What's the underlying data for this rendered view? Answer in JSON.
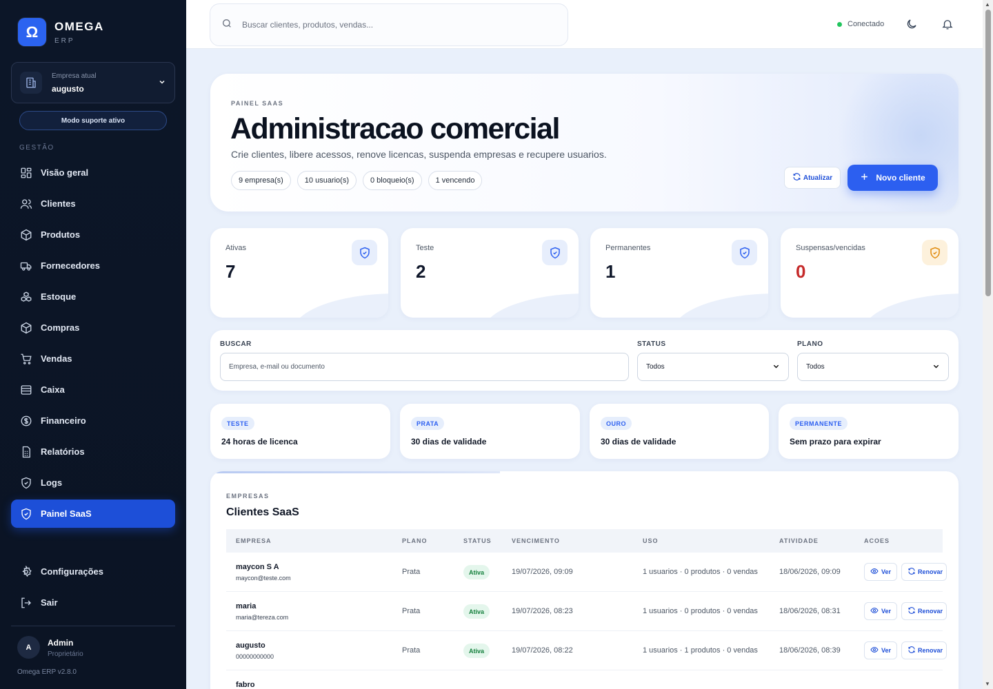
{
  "brand": {
    "logo_glyph": "Ω",
    "name": "OMEGA",
    "sub": "ERP"
  },
  "company": {
    "label": "Empresa atual",
    "name": "augusto"
  },
  "support_badge": "Modo suporte ativo",
  "sidebar": {
    "section": "GESTÃO",
    "items": [
      {
        "label": "Visão geral",
        "icon": "grid-icon"
      },
      {
        "label": "Clientes",
        "icon": "users-icon"
      },
      {
        "label": "Produtos",
        "icon": "package-icon"
      },
      {
        "label": "Fornecedores",
        "icon": "truck-icon"
      },
      {
        "label": "Estoque",
        "icon": "boxes-icon"
      },
      {
        "label": "Compras",
        "icon": "package-icon"
      },
      {
        "label": "Vendas",
        "icon": "cart-icon"
      },
      {
        "label": "Caixa",
        "icon": "wallet-icon"
      },
      {
        "label": "Financeiro",
        "icon": "dollar-icon"
      },
      {
        "label": "Relatórios",
        "icon": "report-icon"
      },
      {
        "label": "Logs",
        "icon": "shield-icon"
      },
      {
        "label": "Painel SaaS",
        "icon": "shield-icon",
        "active": true
      }
    ],
    "bottom_items": [
      {
        "label": "Configurações",
        "icon": "gear-icon"
      },
      {
        "label": "Sair",
        "icon": "logout-icon"
      }
    ],
    "user": {
      "initial": "A",
      "name": "Admin",
      "role": "Proprietário"
    },
    "version": "Omega ERP v2.8.0"
  },
  "topbar": {
    "search_placeholder": "Buscar clientes, produtos, vendas...",
    "status": "Conectado",
    "status_color": "#22c55e"
  },
  "hero": {
    "kicker": "PAINEL SAAS",
    "title": "Administracao comercial",
    "subtitle": "Crie clientes, libere acessos, renove licencas, suspenda empresas e recupere usuarios.",
    "chips": [
      "9 empresa(s)",
      "10 usuario(s)",
      "0 bloqueio(s)",
      "1 vencendo"
    ],
    "refresh_label": "Atualizar",
    "new_label": "Novo cliente"
  },
  "stats": [
    {
      "label": "Ativas",
      "value": "7"
    },
    {
      "label": "Teste",
      "value": "2"
    },
    {
      "label": "Permanentes",
      "value": "1"
    },
    {
      "label": "Suspensas/vencidas",
      "value": "0",
      "accent": "#c52a2a"
    }
  ],
  "filters": {
    "search_label": "BUSCAR",
    "search_placeholder": "Empresa, e-mail ou documento",
    "status_label": "STATUS",
    "status_value": "Todos",
    "plan_label": "PLANO",
    "plan_value": "Todos"
  },
  "plans": [
    {
      "tag": "TESTE",
      "desc": "24 horas de licenca"
    },
    {
      "tag": "PRATA",
      "desc": "30 dias de validade"
    },
    {
      "tag": "OURO",
      "desc": "30 dias de validade"
    },
    {
      "tag": "PERMANENTE",
      "desc": "Sem prazo para expirar"
    }
  ],
  "table": {
    "kicker": "EMPRESAS",
    "title": "Clientes SaaS",
    "columns": [
      "EMPRESA",
      "PLANO",
      "STATUS",
      "VENCIMENTO",
      "USO",
      "ATIVIDADE",
      "ACOES"
    ],
    "view_label": "Ver",
    "renew_label": "Renovar",
    "rows": [
      {
        "name": "maycon S A",
        "email": "maycon@teste.com",
        "plan": "Prata",
        "status": "Ativa",
        "due": "19/07/2026, 09:09",
        "usage": "1 usuarios · 0 produtos · 0 vendas",
        "activity": "18/06/2026, 09:09"
      },
      {
        "name": "maria",
        "email": "maria@tereza.com",
        "plan": "Prata",
        "status": "Ativa",
        "due": "19/07/2026, 08:23",
        "usage": "1 usuarios · 0 produtos · 0 vendas",
        "activity": "18/06/2026, 08:31"
      },
      {
        "name": "augusto",
        "email": "00000000000",
        "plan": "Prata",
        "status": "Ativa",
        "due": "19/07/2026, 08:22",
        "usage": "1 usuarios · 1 produtos · 0 vendas",
        "activity": "18/06/2026, 08:39"
      },
      {
        "name": "fabro",
        "email": "",
        "plan": "",
        "status": "",
        "due": "",
        "usage": "",
        "activity": ""
      }
    ]
  }
}
